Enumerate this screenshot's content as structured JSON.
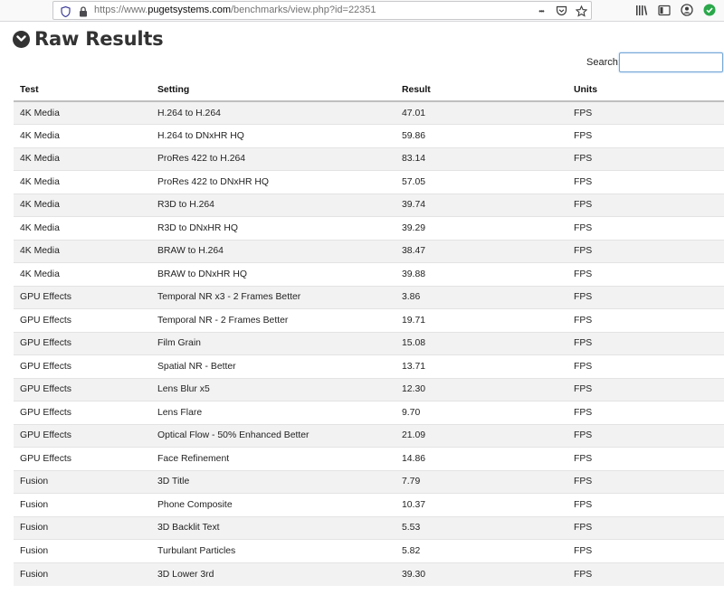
{
  "browser": {
    "url_prefix": "https://www.",
    "url_host": "pugetsystems.com",
    "url_path": "/benchmarks/view.php?id=22351",
    "more_glyph": "•••"
  },
  "page": {
    "title": "Raw Results",
    "search_label": "Search:",
    "search_value": ""
  },
  "table": {
    "headers": [
      "Test",
      "Setting",
      "Result",
      "Units"
    ],
    "rows": [
      {
        "test": "4K Media",
        "setting": "H.264 to H.264",
        "result": "47.01",
        "units": "FPS"
      },
      {
        "test": "4K Media",
        "setting": "H.264 to DNxHR HQ",
        "result": "59.86",
        "units": "FPS"
      },
      {
        "test": "4K Media",
        "setting": "ProRes 422 to H.264",
        "result": "83.14",
        "units": "FPS"
      },
      {
        "test": "4K Media",
        "setting": "ProRes 422 to DNxHR HQ",
        "result": "57.05",
        "units": "FPS"
      },
      {
        "test": "4K Media",
        "setting": "R3D to H.264",
        "result": "39.74",
        "units": "FPS"
      },
      {
        "test": "4K Media",
        "setting": "R3D to DNxHR HQ",
        "result": "39.29",
        "units": "FPS"
      },
      {
        "test": "4K Media",
        "setting": "BRAW to H.264",
        "result": "38.47",
        "units": "FPS"
      },
      {
        "test": "4K Media",
        "setting": "BRAW to DNxHR HQ",
        "result": "39.88",
        "units": "FPS"
      },
      {
        "test": "GPU Effects",
        "setting": "Temporal NR x3 - 2 Frames Better",
        "result": "3.86",
        "units": "FPS"
      },
      {
        "test": "GPU Effects",
        "setting": "Temporal NR - 2 Frames Better",
        "result": "19.71",
        "units": "FPS"
      },
      {
        "test": "GPU Effects",
        "setting": "Film Grain",
        "result": "15.08",
        "units": "FPS"
      },
      {
        "test": "GPU Effects",
        "setting": "Spatial NR - Better",
        "result": "13.71",
        "units": "FPS"
      },
      {
        "test": "GPU Effects",
        "setting": "Lens Blur x5",
        "result": "12.30",
        "units": "FPS"
      },
      {
        "test": "GPU Effects",
        "setting": "Lens Flare",
        "result": "9.70",
        "units": "FPS"
      },
      {
        "test": "GPU Effects",
        "setting": "Optical Flow - 50% Enhanced Better",
        "result": "21.09",
        "units": "FPS"
      },
      {
        "test": "GPU Effects",
        "setting": "Face Refinement",
        "result": "14.86",
        "units": "FPS"
      },
      {
        "test": "Fusion",
        "setting": "3D Title",
        "result": "7.79",
        "units": "FPS"
      },
      {
        "test": "Fusion",
        "setting": "Phone Composite",
        "result": "10.37",
        "units": "FPS"
      },
      {
        "test": "Fusion",
        "setting": "3D Backlit Text",
        "result": "5.53",
        "units": "FPS"
      },
      {
        "test": "Fusion",
        "setting": "Turbulant Particles",
        "result": "5.82",
        "units": "FPS"
      },
      {
        "test": "Fusion",
        "setting": "3D Lower 3rd",
        "result": "39.30",
        "units": "FPS"
      }
    ]
  },
  "icons": {
    "shield": "shield-icon",
    "lock": "lock-icon",
    "more": "more-icon",
    "pocket": "pocket-icon",
    "bookmark": "star-icon",
    "library": "library-icon",
    "sidebar": "sidebar-icon",
    "account": "account-icon",
    "extension": "extension-icon",
    "collapse": "chevron-circle-down-icon"
  },
  "colors": {
    "stripe": "#f2f2f2",
    "heading": "#333333",
    "search_focus": "#74a6d6"
  }
}
